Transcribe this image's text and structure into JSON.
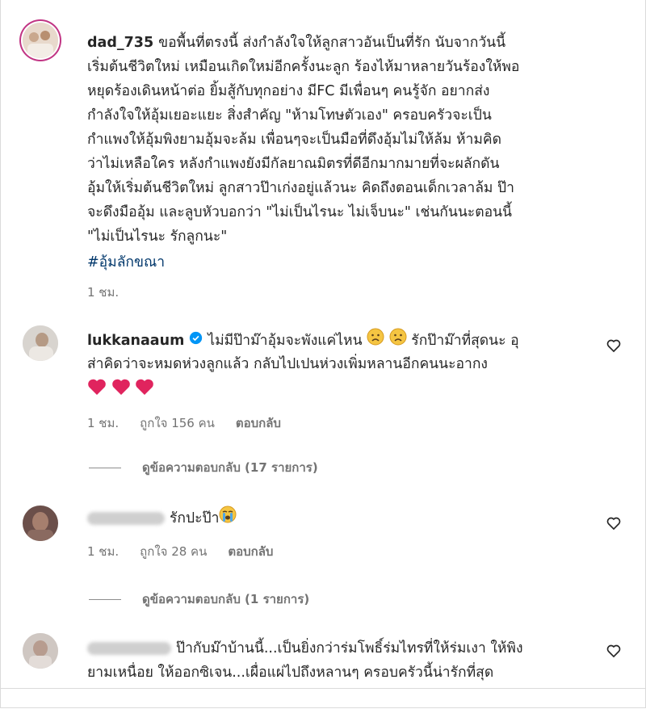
{
  "comments": [
    {
      "username": "dad_735",
      "text": "ขอพื้นที่ตรงนี้ ส่งกำลังใจให้ลูกสาวอันเป็นที่รัก นับจากวันนี้",
      "lines": [
        "เริ่มต้นชีวิตใหม่ เหมือนเกิดใหม่อีกครั้งนะลูก ร้องไห้มาหลายวันร้องให้พอ",
        "หยุดร้องเดินหน้าต่อ ยิ้มสู้กับทุกอย่าง มีFC มีเพื่อนๆ คนรู้จัก อยากส่ง",
        "กำลังใจให้อุ้มเยอะแยะ สิ่งสำคัญ \"ห้ามโทษตัวเอง\" ครอบครัวจะเป็น",
        "กำแพงให้อุ้มพิงยามอุ้มจะล้ม เพื่อนๆจะเป็นมือที่ดึงอุ้มไม่ให้ล้ม ห้ามคิด",
        "ว่าไม่เหลือใคร หลังกำแพงยังมีกัลยาณมิตรที่ดีอีกมากมายที่จะผลักดัน",
        "อุ้มให้เริ่มต้นชีวิตใหม่ ลูกสาวป๊าเก่งอยู่แล้วนะ คิดถึงตอนเด็กเวลาล้ม ป๊า",
        "จะดึงมืออุ้ม และลูบหัวบอกว่า \"ไม่เป็นไรนะ ไม่เจ็บนะ\" เช่นกันนะตอนนี้",
        "\"ไม่เป็นไรนะ รักลูกนะ\""
      ],
      "hashtag": "#อุ้มลักขณา",
      "time": "1 ชม."
    },
    {
      "username": "lukkanaaum",
      "text": "ไม่มีป๊าม๊าอุ้มจะพังแค่ไหน",
      "text_after": "รักป๊าม๊าที่สุดนะ อุ",
      "line2": "ส่าคิดว่าจะหมดห่วงลูกแล้ว กลับไปเปนห่วงเพิ่มหลานอีกคนนะอากง",
      "time": "1 ชม.",
      "likes": "ถูกใจ 156 คน",
      "reply": "ตอบกลับ",
      "view_replies": "ดูข้อความตอบกลับ (17 รายการ)"
    },
    {
      "text": "รักปะป๊า",
      "time": "1 ชม.",
      "likes": "ถูกใจ 28 คน",
      "reply": "ตอบกลับ",
      "view_replies": "ดูข้อความตอบกลับ (1 รายการ)"
    },
    {
      "text": "ป๊ากับม๊าบ้านนี้...เป็นยิ่งกว่าร่มโพธิ์ร่มไทรที่ให้ร่มเงา ให้พิง",
      "line2": "ยามเหนื่อย ให้ออกซิเจน...เผื่อแผ่ไปถึงหลานๆ ครอบครัวนี้น่ารักที่สุด"
    }
  ],
  "icons": {
    "heart": "heart-outline-icon",
    "verified": "verified-badge-icon",
    "sad": "sad-face-emoji",
    "crying": "loudly-crying-emoji",
    "red_heart": "red-heart-emoji"
  },
  "colors": {
    "text": "#262626",
    "secondary": "#737373",
    "link": "#00376b",
    "verified": "#0095f6",
    "heart_emoji": "#e0245e"
  }
}
